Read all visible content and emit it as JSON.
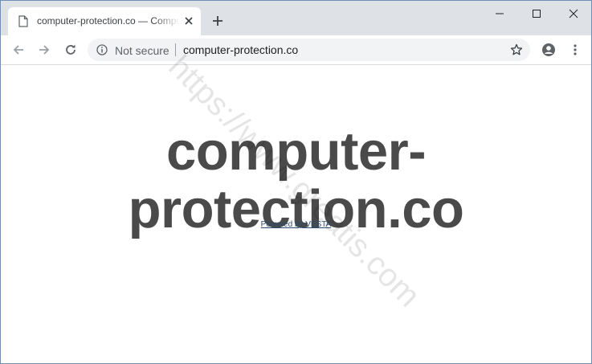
{
  "tab": {
    "title": "computer-protection.co — Computer Protection"
  },
  "toolbar": {
    "security_label": "Not secure",
    "url": "computer-protection.co"
  },
  "page": {
    "heading": "computer-protection.co",
    "powered_by": "Powered by VESTA"
  },
  "watermark": "https://www.greatis.com",
  "icons": {
    "tab": "page-icon",
    "close": "close-icon",
    "new_tab": "plus-icon",
    "nav": [
      "arrow-left-icon",
      "arrow-right-icon",
      "reload-icon"
    ],
    "info": "info-icon",
    "bookmark": "star-icon",
    "profile": "account-icon",
    "menu": "kebab-menu-icon"
  },
  "colors": {
    "tabstrip": "#dee1e6",
    "omnibox": "#f1f3f4",
    "heading": "#4a4a4a",
    "link": "#294a6e"
  }
}
